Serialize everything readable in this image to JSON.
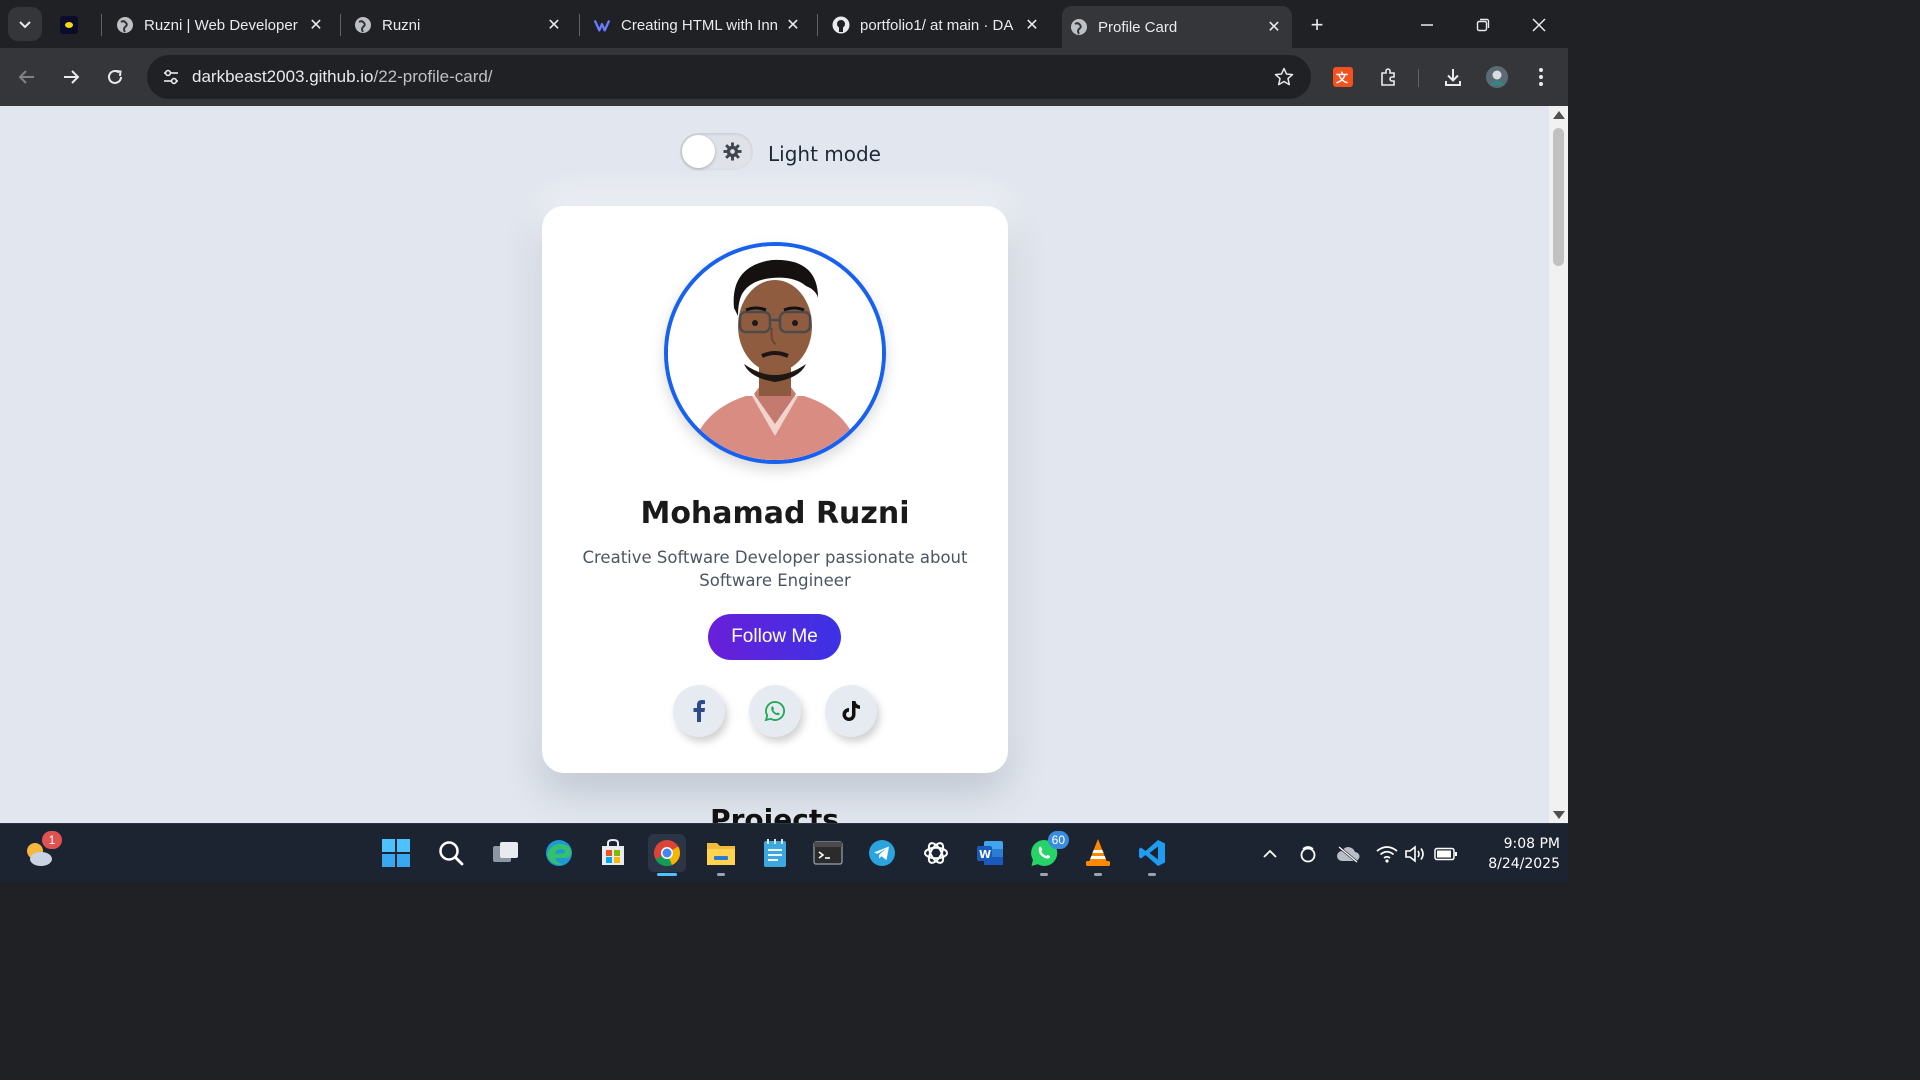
{
  "browser": {
    "tabs": [
      {
        "title": "",
        "favicon": "dark-logo-icon"
      },
      {
        "title": "Ruzni | Web Developer",
        "favicon": "globe-icon"
      },
      {
        "title": "Ruzni",
        "favicon": "globe-icon"
      },
      {
        "title": "Creating HTML with Inn",
        "favicon": "chat-ai-icon"
      },
      {
        "title": "portfolio1/ at main · DA",
        "favicon": "github-icon"
      },
      {
        "title": "Profile Card",
        "favicon": "globe-icon",
        "active": true
      }
    ],
    "url_host": "darkbeast2003.github.io",
    "url_path": "/22-profile-card/"
  },
  "page": {
    "mode_label": "Light mode",
    "profile": {
      "name": "Mohamad Ruzni",
      "bio": "Creative Software Developer passionate about Software Engineer",
      "follow_label": "Follow Me"
    },
    "socials": [
      "facebook-icon",
      "whatsapp-icon",
      "tiktok-icon"
    ],
    "next_section": "Projects"
  },
  "taskbar": {
    "weather_badge": "1",
    "whatsapp_badge": "60",
    "time": "9:08 PM",
    "date": "8/24/2025"
  },
  "colors": {
    "page_bg": "#e2e7ef",
    "accent_border": "#1861f0",
    "button_gradient_start": "#6a1fd8",
    "button_gradient_end": "#3b32e6"
  }
}
